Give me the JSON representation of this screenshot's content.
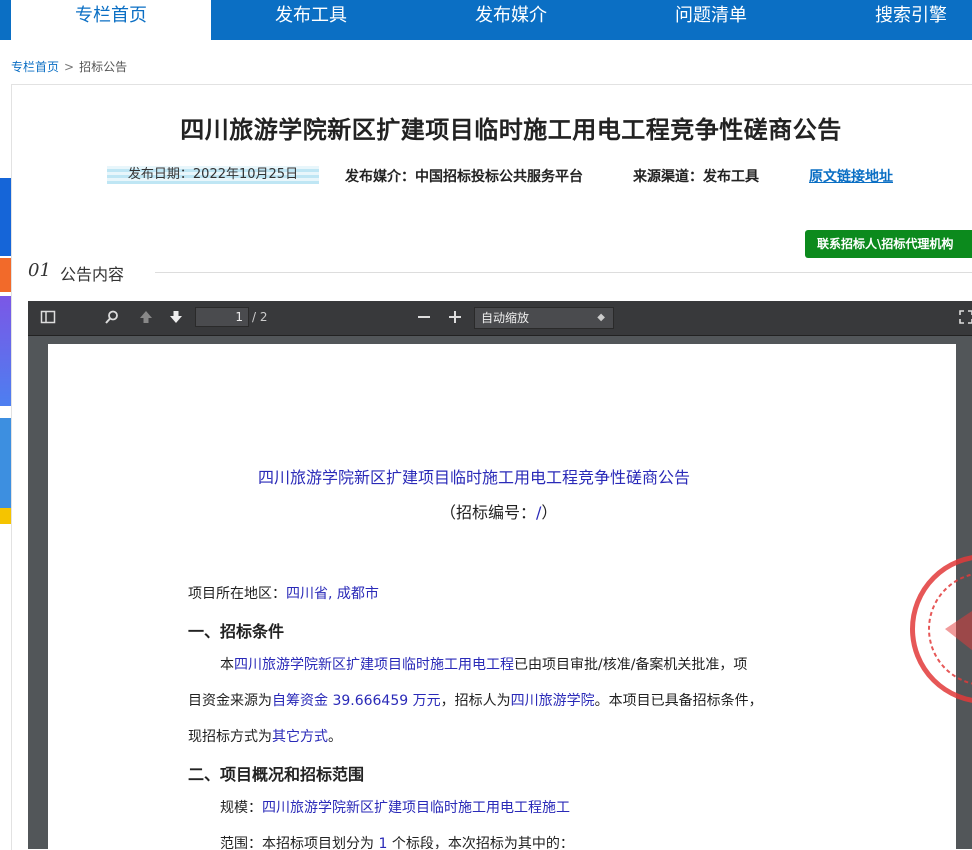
{
  "nav": {
    "tabs": [
      {
        "label": "专栏首页",
        "active": true
      },
      {
        "label": "发布工具",
        "active": false
      },
      {
        "label": "发布媒介",
        "active": false
      },
      {
        "label": "问题清单",
        "active": false
      },
      {
        "label": "搜索引擎",
        "active": false
      }
    ]
  },
  "breadcrumb": {
    "home": "专栏首页",
    "sep": ">",
    "current": "招标公告"
  },
  "article": {
    "title": "四川旅游学院新区扩建项目临时施工用电工程竞争性磋商公告",
    "publish_date": "发布日期：2022年10月25日",
    "media": "发布媒介：中国招标投标公共服务平台",
    "source": "来源渠道：发布工具",
    "original_link": "原文链接地址",
    "contact_button": "联系招标人\\招标代理机构",
    "section_number": "01",
    "section_title": "公告内容"
  },
  "pdf": {
    "current_page": "1",
    "page_count": "/ 2",
    "zoom_label": "自动缩放",
    "zoom_caret": "◆"
  },
  "doc": {
    "title": "四川旅游学院新区扩建项目临时施工用电工程竞争性磋商公告",
    "code_prefix": "（招标编号：",
    "code_value": "/",
    "code_suffix": "）",
    "region_label": "项目所在地区：",
    "region_value": "四川省, 成都市",
    "h1": "一、招标条件",
    "p1a": "本",
    "p1b": "四川旅游学院新区扩建项目临时施工用电工程",
    "p1c": "已由项目审批/核准/备案机关批准，项",
    "p2a": "目资金来源为",
    "p2b": "自筹资金 39.666459 万元",
    "p2c": "，招标人为",
    "p2d": "四川旅游学院",
    "p2e": "。本项目已具备招标条件，",
    "p3a": "现招标方式为",
    "p3b": "其它方式",
    "p3c": "。",
    "h2": "二、项目概况和招标范围",
    "scale_label": "规模：",
    "scale_value": "四川旅游学院新区扩建项目临时施工用电工程施工",
    "scope_a": "范围：本招标项目划分为 ",
    "scope_b": "1",
    "scope_c": " 个标段，本次招标为其中的："
  },
  "colors": {
    "nav": "#0b6fc4",
    "button": "#0c8a1d",
    "doc_link": "#2a2ab8",
    "seal": "#e23a3a"
  }
}
